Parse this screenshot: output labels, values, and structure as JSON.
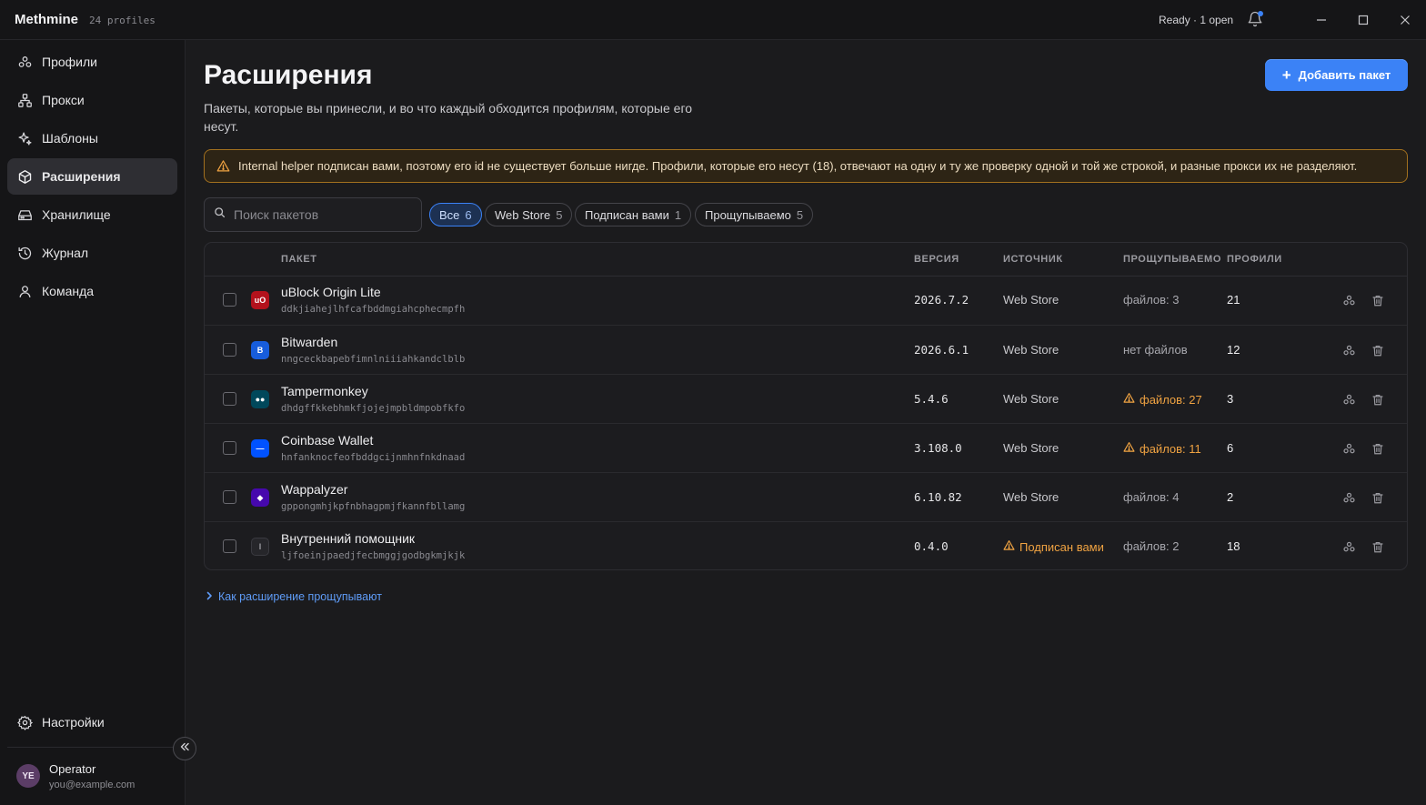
{
  "app": {
    "name": "Methmine",
    "profiles_count": "24 profiles",
    "status": "Ready · 1 open"
  },
  "sidebar": {
    "items": [
      {
        "label": "Профили",
        "icon": "profiles-icon"
      },
      {
        "label": "Прокси",
        "icon": "proxy-icon"
      },
      {
        "label": "Шаблоны",
        "icon": "templates-icon"
      },
      {
        "label": "Расширения",
        "icon": "extensions-icon",
        "active": true
      },
      {
        "label": "Хранилище",
        "icon": "storage-icon"
      },
      {
        "label": "Журнал",
        "icon": "history-icon"
      },
      {
        "label": "Команда",
        "icon": "team-icon"
      }
    ],
    "settings": "Настройки",
    "user": {
      "initials": "YE",
      "name": "Operator",
      "email": "you@example.com"
    }
  },
  "header": {
    "title": "Расширения",
    "description": "Пакеты, которые вы принесли, и во что каждый обходится профилям, которые его несут.",
    "add_button": "Добавить пакет"
  },
  "warning": "Internal helper подписан вами, поэтому его id не существует больше нигде. Профили, которые его несут (18), отвечают на одну и ту же проверку одной и той же строкой, и разные прокси их не разделяют.",
  "search": {
    "placeholder": "Поиск пакетов"
  },
  "filters": [
    {
      "label": "Все",
      "count": "6",
      "active": true
    },
    {
      "label": "Web Store",
      "count": "5"
    },
    {
      "label": "Подписан вами",
      "count": "1"
    },
    {
      "label": "Прощупываемо",
      "count": "5"
    }
  ],
  "table": {
    "columns": {
      "package": "ПАКЕТ",
      "version": "ВЕРСИЯ",
      "source": "ИСТОЧНИК",
      "probeable": "ПРОЩУПЫВАЕМО",
      "profiles": "ПРОФИЛИ"
    },
    "rows": [
      {
        "name": "uBlock Origin Lite",
        "id": "ddkjiahejlhfcafbddmgiahcphecmpfh",
        "version": "2026.7.2",
        "source": "Web Store",
        "source_warn": false,
        "probe": "файлов: 3",
        "probe_warn": false,
        "profiles": "21",
        "icon_color": "#b3121c",
        "icon_glyph": "uO"
      },
      {
        "name": "Bitwarden",
        "id": "nngceckbapebfimnlniiiahkandclblb",
        "version": "2026.6.1",
        "source": "Web Store",
        "source_warn": false,
        "probe": "нет файлов",
        "probe_warn": false,
        "profiles": "12",
        "icon_color": "#175ddc",
        "icon_glyph": "B"
      },
      {
        "name": "Tampermonkey",
        "id": "dhdgffkkebhmkfjojejmpbldmpobfkfo",
        "version": "5.4.6",
        "source": "Web Store",
        "source_warn": false,
        "probe": "файлов: 27",
        "probe_warn": true,
        "profiles": "3",
        "icon_color": "#00485b",
        "icon_glyph": "●●"
      },
      {
        "name": "Coinbase Wallet",
        "id": "hnfanknocfeofbddgcijnmhnfnkdnaad",
        "version": "3.108.0",
        "source": "Web Store",
        "source_warn": false,
        "probe": "файлов: 11",
        "probe_warn": true,
        "profiles": "6",
        "icon_color": "#0052ff",
        "icon_glyph": "—"
      },
      {
        "name": "Wappalyzer",
        "id": "gppongmhjkpfnbhagpmjfkannfbllamg",
        "version": "6.10.82",
        "source": "Web Store",
        "source_warn": false,
        "probe": "файлов: 4",
        "probe_warn": false,
        "profiles": "2",
        "icon_color": "#4608ad",
        "icon_glyph": "◆"
      },
      {
        "name": "Внутренний помощник",
        "id": "ljfoeinjpaedjfecbmggjgodbgkmjkjk",
        "version": "0.4.0",
        "source": "Подписан вами",
        "source_warn": true,
        "probe": "файлов: 2",
        "probe_warn": false,
        "profiles": "18",
        "icon_color": "#26262a",
        "icon_glyph": "I"
      }
    ]
  },
  "footer_link": "Как расширение прощупывают",
  "colors": {
    "accent": "#3b82f6",
    "warning": "#f0a342",
    "background": "#1b1b1d",
    "sidebar": "#151517"
  }
}
